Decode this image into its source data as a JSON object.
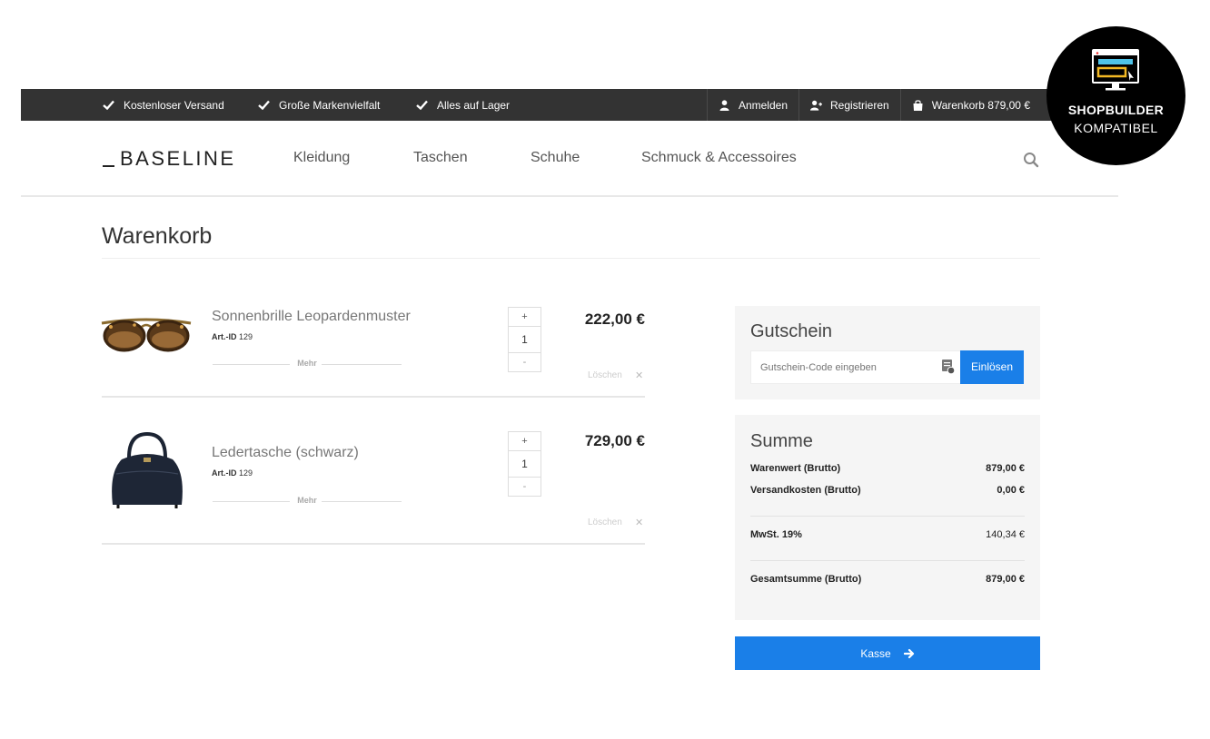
{
  "topbar": {
    "usps": [
      "Kostenloser Versand",
      "Große Markenvielfalt",
      "Alles auf Lager"
    ],
    "login": "Anmelden",
    "register": "Registrieren",
    "cart": "Warenkorb 879,00 €"
  },
  "header": {
    "logo": "BASELINE",
    "nav": [
      "Kleidung",
      "Taschen",
      "Schuhe",
      "Schmuck & Accessoires"
    ]
  },
  "page": {
    "title": "Warenkorb"
  },
  "items": [
    {
      "name": "Sonnenbrille Leopardenmuster",
      "artid_label": "Art.-ID",
      "artid": "129",
      "more": "Mehr",
      "qty": "1",
      "price": "222,00 €",
      "delete": "Löschen"
    },
    {
      "name": "Ledertasche (schwarz)",
      "artid_label": "Art.-ID",
      "artid": "129",
      "more": "Mehr",
      "qty": "1",
      "price": "729,00 €",
      "delete": "Löschen"
    }
  ],
  "qty_controls": {
    "plus": "+",
    "minus": "-"
  },
  "coupon": {
    "title": "Gutschein",
    "placeholder": "Gutschein-Code eingeben",
    "button": "Einlösen"
  },
  "summary": {
    "title": "Summe",
    "goods_label": "Warenwert (Brutto)",
    "goods_value": "879,00 €",
    "shipping_label": "Versandkosten (Brutto)",
    "shipping_value": "0,00 €",
    "vat_label": "MwSt. 19%",
    "vat_value": "140,34 €",
    "total_label": "Gesamtsumme (Brutto)",
    "total_value": "879,00 €"
  },
  "checkout": {
    "label": "Kasse"
  },
  "badge": {
    "line1": "SHOPBUILDER",
    "line2": "KOMPATIBEL"
  },
  "colors": {
    "topbar": "#333333",
    "accent": "#1a7fe8",
    "panel": "#f5f5f5"
  }
}
